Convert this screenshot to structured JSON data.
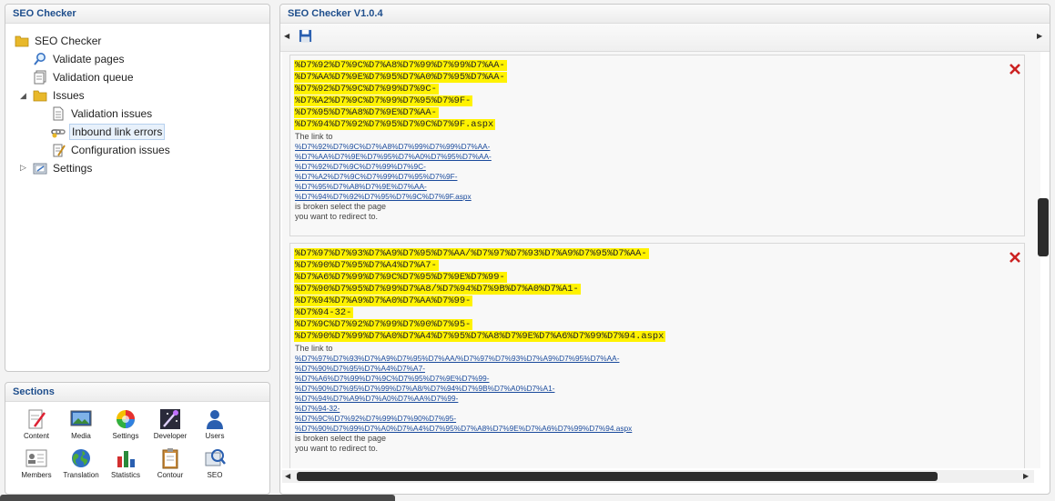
{
  "tree": {
    "title": "SEO Checker",
    "nodes": {
      "root": "SEO Checker",
      "validate_pages": "Validate pages",
      "validation_queue": "Validation queue",
      "issues": "Issues",
      "validation_issues": "Validation issues",
      "inbound_link_errors": "Inbound link errors",
      "configuration_issues": "Configuration issues",
      "settings": "Settings"
    }
  },
  "sections": {
    "title": "Sections",
    "items": [
      "Content",
      "Media",
      "Settings",
      "Developer",
      "Users",
      "Members",
      "Translation",
      "Statistics",
      "Contour",
      "SEO"
    ]
  },
  "main": {
    "title": "SEO Checker V1.0.4",
    "entries": [
      {
        "url_lines": [
          "%D7%92%D7%9C%D7%A8%D7%99%D7%99%D7%AA-",
          "%D7%AA%D7%9E%D7%95%D7%A0%D7%95%D7%AA-",
          "%D7%92%D7%9C%D7%99%D7%9C-",
          "%D7%A2%D7%9C%D7%99%D7%95%D7%9F-",
          "%D7%95%D7%A8%D7%9E%D7%AA-",
          "%D7%94%D7%92%D7%95%D7%9C%D7%9F.aspx"
        ],
        "link_label": "The link to",
        "link_lines": [
          "%D7%92%D7%9C%D7%A8%D7%99%D7%99%D7%AA-",
          "%D7%AA%D7%9E%D7%95%D7%A0%D7%95%D7%AA-",
          "%D7%92%D7%9C%D7%99%D7%9C-",
          "%D7%A2%D7%9C%D7%99%D7%95%D7%9F-",
          "%D7%95%D7%A8%D7%9E%D7%AA-",
          "%D7%94%D7%92%D7%95%D7%9C%D7%9F.aspx"
        ],
        "broken_text_1": "is broken select the page",
        "broken_text_2": "you want to redirect to."
      },
      {
        "url_lines": [
          "%D7%97%D7%93%D7%A9%D7%95%D7%AA/%D7%97%D7%93%D7%A9%D7%95%D7%AA-",
          "%D7%90%D7%95%D7%A4%D7%A7-",
          "%D7%A6%D7%99%D7%9C%D7%95%D7%9E%D7%99-",
          "%D7%90%D7%95%D7%99%D7%A8/%D7%94%D7%9B%D7%A0%D7%A1-",
          "%D7%94%D7%A9%D7%A0%D7%AA%D7%99-",
          "%D7%94-32-",
          "%D7%9C%D7%92%D7%99%D7%90%D7%95-",
          "%D7%90%D7%99%D7%A0%D7%A4%D7%95%D7%A8%D7%9E%D7%A6%D7%99%D7%94.aspx"
        ],
        "link_label": "The link to",
        "link_lines": [
          "%D7%97%D7%93%D7%A9%D7%95%D7%AA/%D7%97%D7%93%D7%A9%D7%95%D7%AA-",
          "%D7%90%D7%95%D7%A4%D7%A7-",
          "%D7%A6%D7%99%D7%9C%D7%95%D7%9E%D7%99-",
          "%D7%90%D7%95%D7%99%D7%A8/%D7%94%D7%9B%D7%A0%D7%A1-",
          "%D7%94%D7%A9%D7%A0%D7%AA%D7%99-",
          "%D7%94-32-",
          "%D7%9C%D7%92%D7%99%D7%90%D7%95-",
          "%D7%90%D7%99%D7%A0%D7%A4%D7%95%D7%A8%D7%9E%D7%A6%D7%99%D7%94.aspx"
        ],
        "broken_text_1": "is broken select the page",
        "broken_text_2": "you want to redirect to."
      }
    ]
  },
  "colors": {
    "highlight": "#fff200",
    "title_blue": "#1e4e8c",
    "link_blue": "#1a4a9c",
    "close_red": "#cc2222"
  },
  "icons": {
    "folder": "folder-icon",
    "search": "search-icon",
    "queue": "queue-icon",
    "document": "document-icon",
    "link_error": "link-error-icon",
    "config": "config-icon",
    "settings": "settings-icon",
    "save": "save-icon",
    "close": "close-icon"
  }
}
